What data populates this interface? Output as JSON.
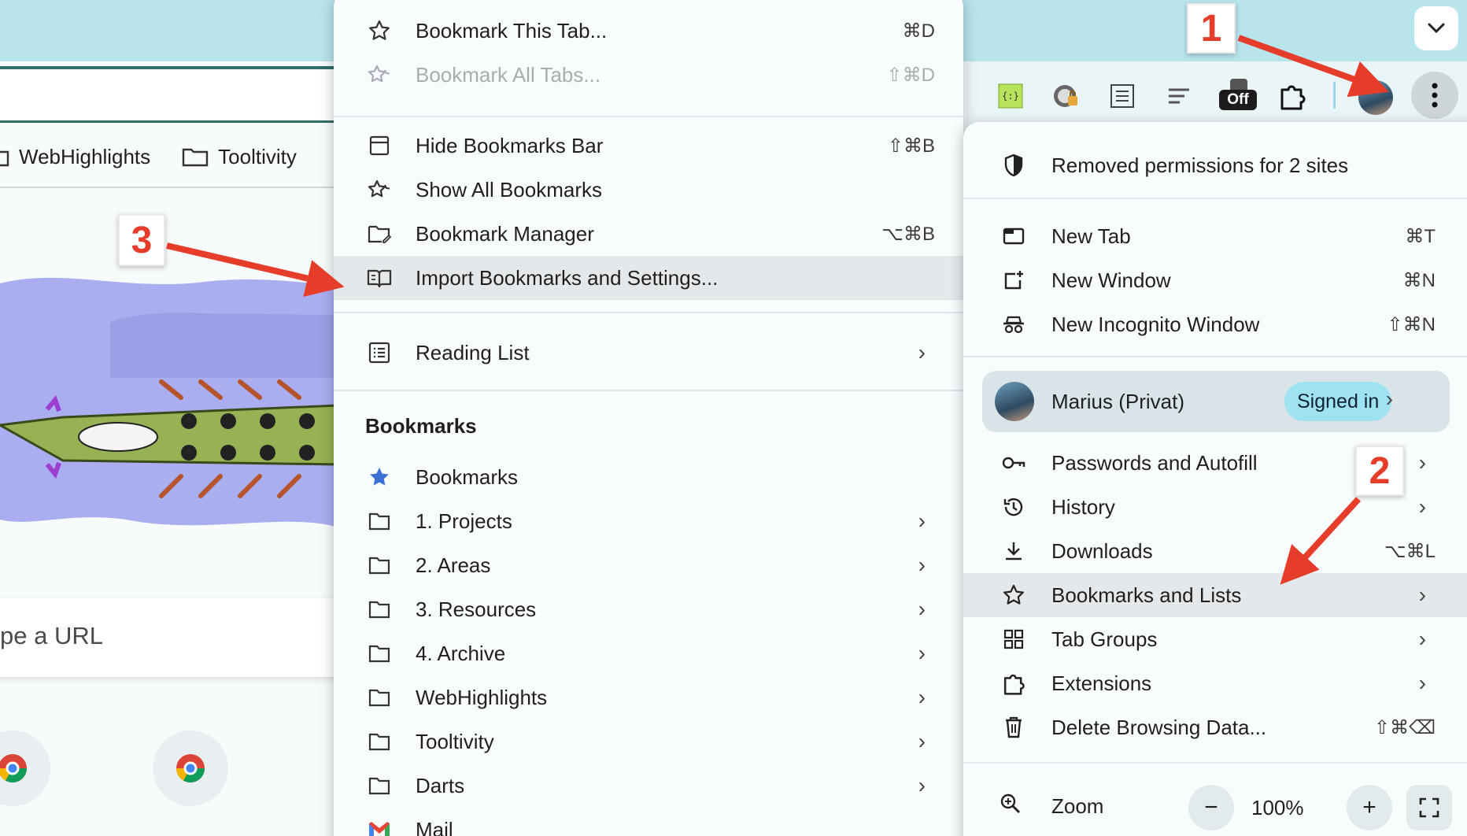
{
  "background": {
    "bookmarks_bar": [
      {
        "label": "WebHighlights",
        "icon": "folder-icon"
      },
      {
        "label": "Tooltivity",
        "icon": "folder-icon"
      }
    ],
    "search_placeholder": "pe a URL"
  },
  "annotations": {
    "one": "1",
    "two": "2",
    "three": "3"
  },
  "toolbar": {
    "extension_off_label": "Off",
    "icons": [
      "json-formatter-icon",
      "lock-extension-icon",
      "reader-icon",
      "list-icon",
      "off-badge-icon",
      "puzzle-icon",
      "profile-avatar-icon",
      "kebab-menu-icon"
    ]
  },
  "bookmarks_menu": {
    "bookmark_this_tab": {
      "label": "Bookmark This Tab...",
      "shortcut": "⌘D"
    },
    "bookmark_all_tabs": {
      "label": "Bookmark All Tabs...",
      "shortcut": "⇧⌘D"
    },
    "hide_bar": {
      "label": "Hide Bookmarks Bar",
      "shortcut": "⇧⌘B"
    },
    "show_all": {
      "label": "Show All Bookmarks"
    },
    "manager": {
      "label": "Bookmark Manager",
      "shortcut": "⌥⌘B"
    },
    "import": {
      "label": "Import Bookmarks and Settings..."
    },
    "reading_list": {
      "label": "Reading List"
    },
    "section_title": "Bookmarks",
    "folders": [
      {
        "label": "Bookmarks",
        "icon": "star-filled-icon"
      },
      {
        "label": "1. Projects",
        "icon": "folder-icon"
      },
      {
        "label": "2. Areas",
        "icon": "folder-icon"
      },
      {
        "label": "3. Resources",
        "icon": "folder-icon"
      },
      {
        "label": "4. Archive",
        "icon": "folder-icon"
      },
      {
        "label": "WebHighlights",
        "icon": "folder-icon"
      },
      {
        "label": "Tooltivity",
        "icon": "folder-icon"
      },
      {
        "label": "Darts",
        "icon": "folder-icon"
      },
      {
        "label": "Mail",
        "icon": "gmail-icon"
      }
    ]
  },
  "main_menu": {
    "permissions": {
      "label": "Removed permissions for 2 sites"
    },
    "new_tab": {
      "label": "New Tab",
      "shortcut": "⌘T"
    },
    "new_window": {
      "label": "New Window",
      "shortcut": "⌘N"
    },
    "incognito": {
      "label": "New Incognito Window",
      "shortcut": "⇧⌘N"
    },
    "profile": {
      "name": "Marius (Privat)",
      "status": "Signed in"
    },
    "passwords": {
      "label": "Passwords and Autofill"
    },
    "history": {
      "label": "History"
    },
    "downloads": {
      "label": "Downloads",
      "shortcut": "⌥⌘L"
    },
    "bookmarks_lists": {
      "label": "Bookmarks and Lists"
    },
    "tab_groups": {
      "label": "Tab Groups"
    },
    "extensions": {
      "label": "Extensions"
    },
    "delete_data": {
      "label": "Delete Browsing Data...",
      "shortcut": "⇧⌘⌫"
    },
    "zoom": {
      "label": "Zoom",
      "value": "100%",
      "minus": "−",
      "plus": "+"
    }
  },
  "colors": {
    "accent": "#e63d2b",
    "highlight": "#e4e8ea",
    "pill": "#9fe2f2",
    "tabstrip": "#b8e4ec"
  }
}
